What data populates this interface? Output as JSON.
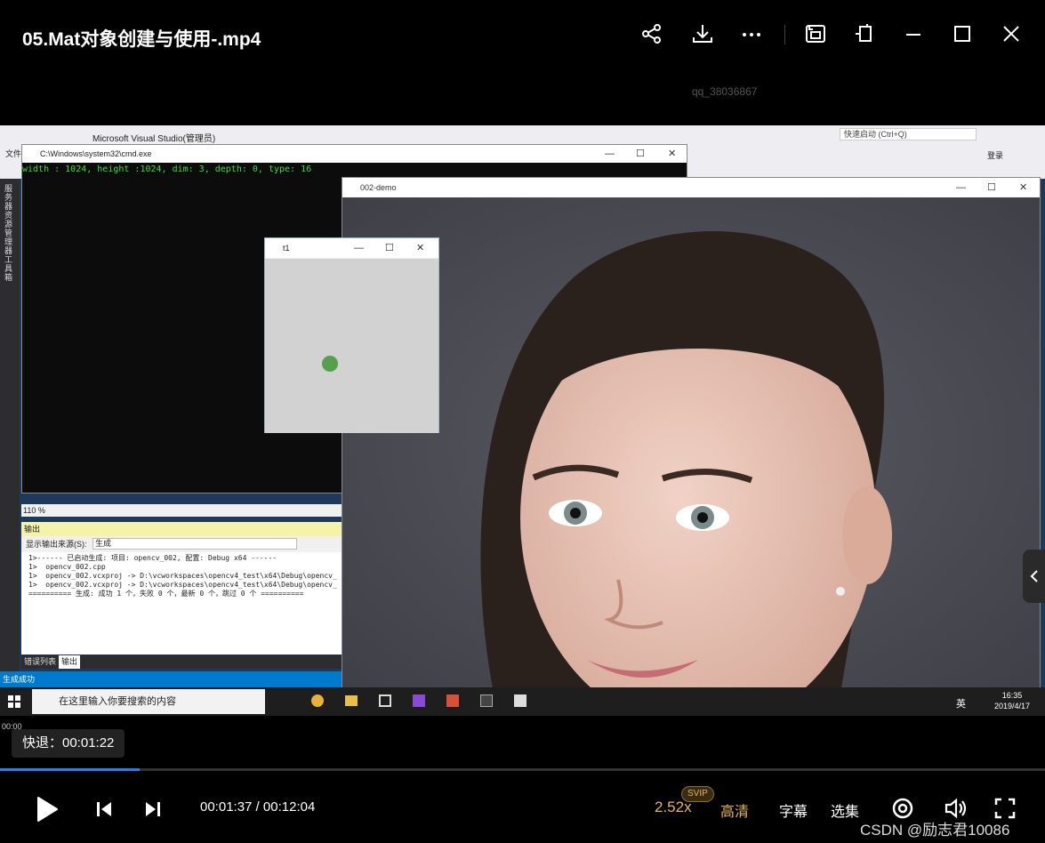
{
  "title_bar": {
    "video_title": "05.Mat对象创建与使用-.mp4",
    "icons": [
      "share-icon",
      "download-icon",
      "more-icon",
      "picture-in-picture-icon",
      "pin-icon",
      "minimize-icon",
      "maximize-icon",
      "close-icon"
    ]
  },
  "watermark_user": "qq_38036867",
  "video": {
    "vs_title": "Microsoft Visual Studio(管理员)",
    "vs_menu_file": "文件",
    "vs_quick_launch": "快速启动 (Ctrl+Q)",
    "vs_login": "登录",
    "vs_side_panel": "服务器资源管理器 工具箱",
    "cmd_title": "C:\\Windows\\system32\\cmd.exe",
    "cmd_output": "width : 1024, height :1024, dim: 3, depth: 0, type: 16",
    "zoom": "110 %",
    "output_header": "输出",
    "output_source_label": "显示输出来源(S):",
    "output_source_value": "生成",
    "output_lines": [
      "1>------ 已启动生成: 项目: opencv_002, 配置: Debug x64 ------",
      "1>  opencv_002.cpp",
      "1>  opencv_002.vcxproj -> D:\\vcworkspaces\\opencv4_test\\x64\\Debug\\opencv_",
      "1>  opencv_002.vcxproj -> D:\\vcworkspaces\\opencv4_test\\x64\\Debug\\opencv_",
      "========== 生成: 成功 1 个，失败 0 个，最新 0 个，跳过 0 个 =========="
    ],
    "tab_errors": "错误列表",
    "tab_output": "输出",
    "status": "生成成功",
    "t1_title": "t1",
    "demo_title": "002-demo",
    "taskbar_search": "在这里输入你要搜索的内容",
    "ime": "英",
    "clock_time": "16:35",
    "clock_date": "2019/4/17"
  },
  "playback": {
    "current_small": "00:00",
    "seek_tip": "快退：00:01:22",
    "current_time": "00:01:37",
    "total_time": "00:12:04",
    "progress": 0.134,
    "speed": "2.52x",
    "svip_badge": "SVIP",
    "quality": "高清",
    "subtitles": "字幕",
    "episodes": "选集"
  },
  "csdn_watermark": "CSDN @励志君10086",
  "colors": {
    "accent_gold": "#e6b45a",
    "progress_blue": "#2c7de8",
    "console_green": "#3ddc3d",
    "vs_status_blue": "#007acc"
  }
}
